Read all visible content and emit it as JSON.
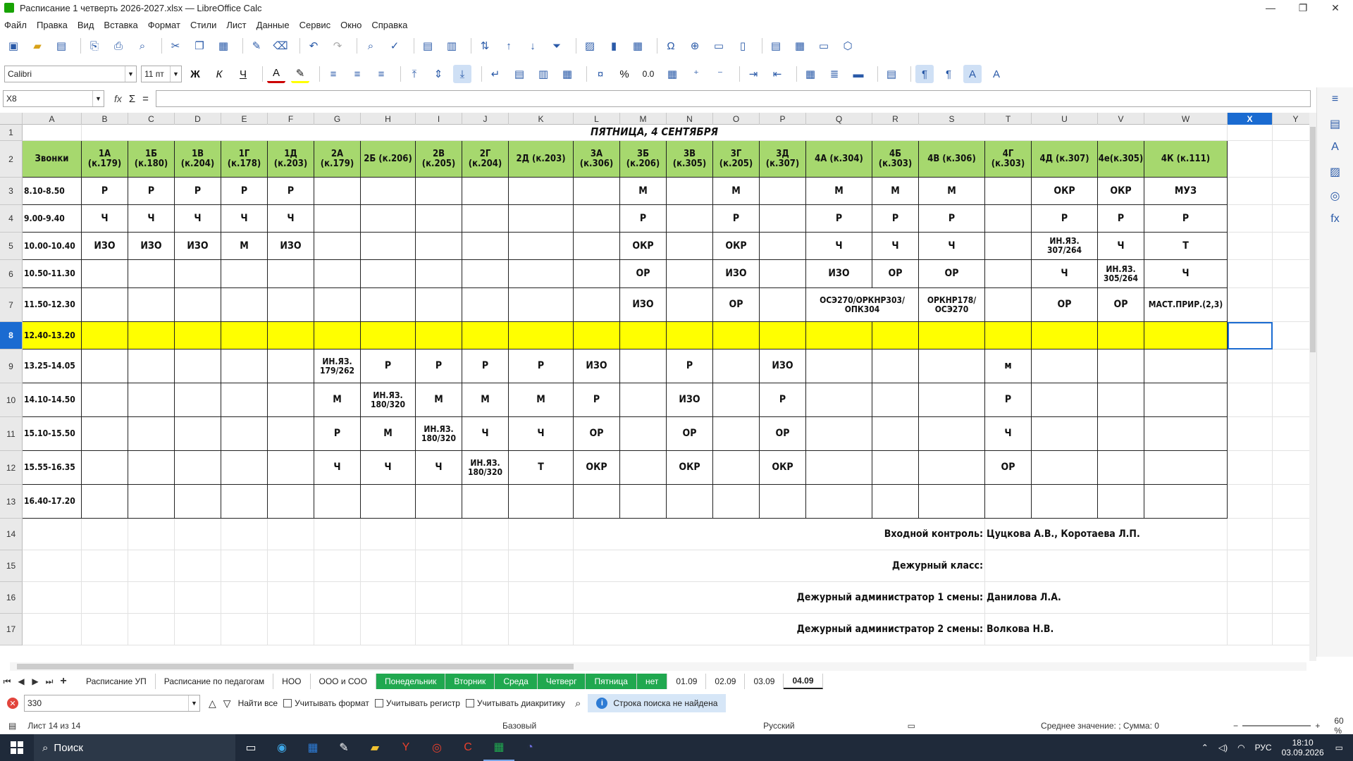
{
  "window": {
    "title": "Расписание 1 четверть 2026-2027.xlsx — LibreOffice Calc",
    "controls": [
      "—",
      "❐",
      "✕"
    ]
  },
  "menu": [
    "Файл",
    "Правка",
    "Вид",
    "Вставка",
    "Формат",
    "Стили",
    "Лист",
    "Данные",
    "Сервис",
    "Окно",
    "Справка"
  ],
  "formatting": {
    "font_name": "Calibri",
    "font_size": "11 пт",
    "bold": "Ж",
    "italic": "К",
    "underline": "Ч",
    "percent": "%",
    "decimal": "0.0"
  },
  "formula_bar": {
    "cell_ref": "X8",
    "fx": "fx",
    "sigma": "Σ",
    "equals": "=",
    "content": ""
  },
  "columns": [
    "A",
    "B",
    "C",
    "D",
    "E",
    "F",
    "G",
    "H",
    "I",
    "J",
    "K",
    "L",
    "M",
    "N",
    "O",
    "P",
    "Q",
    "R",
    "S",
    "T",
    "U",
    "V",
    "W",
    "X",
    "Y"
  ],
  "active_column": "X",
  "rows": [
    "1",
    "2",
    "3",
    "4",
    "5",
    "6",
    "7",
    "8",
    "9",
    "10",
    "11",
    "12",
    "13",
    "14",
    "15",
    "16",
    "17"
  ],
  "active_row": "8",
  "sheet": {
    "title": "ПЯТНИЦА, 4 СЕНТЯБРЯ",
    "headers": [
      "Звонки",
      "1А (к.179)",
      "1Б (к.180)",
      "1В (к.204)",
      "1Г (к.178)",
      "1Д (к.203)",
      "2А (к.179)",
      "2Б (к.206)",
      "2В (к.205)",
      "2Г (к.204)",
      "2Д (к.203)",
      "3А (к.306)",
      "3Б (к.206)",
      "3В (к.305)",
      "3Г (к.205)",
      "3Д (к.307)",
      "4А (к.304)",
      "4Б (к.303)",
      "4В (к.306)",
      "4Г (к.303)",
      "4Д (к.307)",
      "4е(к.305)",
      "4К (к.111)"
    ],
    "body": [
      [
        "8.10-8.50",
        "Р",
        "Р",
        "Р",
        "Р",
        "Р",
        "",
        "",
        "",
        "",
        "",
        "",
        "М",
        "",
        "М",
        "",
        "М",
        "М",
        "М",
        "",
        "ОКР",
        "ОКР",
        "МУЗ"
      ],
      [
        "9.00-9.40",
        "Ч",
        "Ч",
        "Ч",
        "Ч",
        "Ч",
        "",
        "",
        "",
        "",
        "",
        "",
        "Р",
        "",
        "Р",
        "",
        "Р",
        "Р",
        "Р",
        "",
        "Р",
        "Р",
        "Р"
      ],
      [
        "10.00-10.40",
        "ИЗО",
        "ИЗО",
        "ИЗО",
        "М",
        "ИЗО",
        "",
        "",
        "",
        "",
        "",
        "",
        "ОКР",
        "",
        "ОКР",
        "",
        "Ч",
        "Ч",
        "Ч",
        "",
        "ИН.ЯЗ. 307/264",
        "Ч",
        "Т"
      ],
      [
        "10.50-11.30",
        "",
        "",
        "",
        "",
        "",
        "",
        "",
        "",
        "",
        "",
        "",
        "ОР",
        "",
        "ИЗО",
        "",
        "ИЗО",
        "ОР",
        "ОР",
        "",
        "Ч",
        "ИН.ЯЗ. 305/264",
        "Ч"
      ],
      [
        "11.50-12.30",
        "",
        "",
        "",
        "",
        "",
        "",
        "",
        "",
        "",
        "",
        "",
        "ИЗО",
        "",
        "ОР",
        "",
        "ОСЭ270/ОРКНР303/ ОПК304",
        "",
        "ОРКНР178/ ОСЭ270",
        "",
        "ОР",
        "ОР",
        "МАСТ.ПРИР.(2,3)"
      ],
      [
        "12.40-13.20",
        "",
        "",
        "",
        "",
        "",
        "",
        "",
        "",
        "",
        "",
        "",
        "",
        "",
        "",
        "",
        "",
        "",
        "",
        "",
        "",
        "",
        ""
      ],
      [
        "13.25-14.05",
        "",
        "",
        "",
        "",
        "",
        "ИН.ЯЗ. 179/262",
        "Р",
        "Р",
        "Р",
        "Р",
        "ИЗО",
        "",
        "Р",
        "",
        "ИЗО",
        "",
        "",
        "",
        "м",
        "",
        "",
        ""
      ],
      [
        "14.10-14.50",
        "",
        "",
        "",
        "",
        "",
        "М",
        "ИН.ЯЗ. 180/320",
        "М",
        "М",
        "М",
        "Р",
        "",
        "ИЗО",
        "",
        "Р",
        "",
        "",
        "",
        "Р",
        "",
        "",
        ""
      ],
      [
        "15.10-15.50",
        "",
        "",
        "",
        "",
        "",
        "Р",
        "М",
        "ИН.ЯЗ. 180/320",
        "Ч",
        "Ч",
        "ОР",
        "",
        "ОР",
        "",
        "ОР",
        "",
        "",
        "",
        "Ч",
        "",
        "",
        ""
      ],
      [
        "15.55-16.35",
        "",
        "",
        "",
        "",
        "",
        "Ч",
        "Ч",
        "Ч",
        "ИН.ЯЗ. 180/320",
        "Т",
        "ОКР",
        "",
        "ОКР",
        "",
        "ОКР",
        "",
        "",
        "",
        "ОР",
        "",
        "",
        ""
      ],
      [
        "16.40-17.20",
        "",
        "",
        "",
        "",
        "",
        "",
        "",
        "",
        "",
        "",
        "",
        "",
        "",
        "",
        "",
        "",
        "",
        "",
        "",
        "",
        "",
        ""
      ]
    ],
    "notes": [
      {
        "label": "Входной контроль:",
        "value": "Цуцкова А.В., Коротаева Л.П."
      },
      {
        "label": "Дежурный класс:",
        "value": ""
      },
      {
        "label": "Дежурный администратор 1 смены:",
        "value": "Данилова Л.А."
      },
      {
        "label": "Дежурный администратор 2 смены:",
        "value": "Волкова Н.В."
      }
    ]
  },
  "tabs": [
    {
      "label": "Расписание УП",
      "style": "normal"
    },
    {
      "label": "Расписание по педагогам",
      "style": "normal"
    },
    {
      "label": "НОО",
      "style": "normal"
    },
    {
      "label": "ООО и СОО",
      "style": "normal"
    },
    {
      "label": "Понедельник",
      "style": "green"
    },
    {
      "label": "Вторник",
      "style": "green"
    },
    {
      "label": "Среда",
      "style": "green"
    },
    {
      "label": "Четверг",
      "style": "green"
    },
    {
      "label": "Пятница",
      "style": "green"
    },
    {
      "label": "нет",
      "style": "green"
    },
    {
      "label": "01.09",
      "style": "normal"
    },
    {
      "label": "02.09",
      "style": "normal"
    },
    {
      "label": "03.09",
      "style": "normal"
    },
    {
      "label": "04.09",
      "style": "active"
    }
  ],
  "find": {
    "value": "330",
    "find_all": "Найти все",
    "match_format": "Учитывать формат",
    "match_case": "Учитывать регистр",
    "match_diacritics": "Учитывать диакритику",
    "message": "Строка поиска не найдена"
  },
  "status": {
    "sheet": "Лист 14 из 14",
    "style": "Базовый",
    "lang": "Русский",
    "summary": "Среднее значение: ; Сумма: 0",
    "zoom": "60 %"
  },
  "taskbar": {
    "search": "Поиск",
    "lang": "РУС",
    "time": "18:10",
    "date": "03.09.2026"
  }
}
